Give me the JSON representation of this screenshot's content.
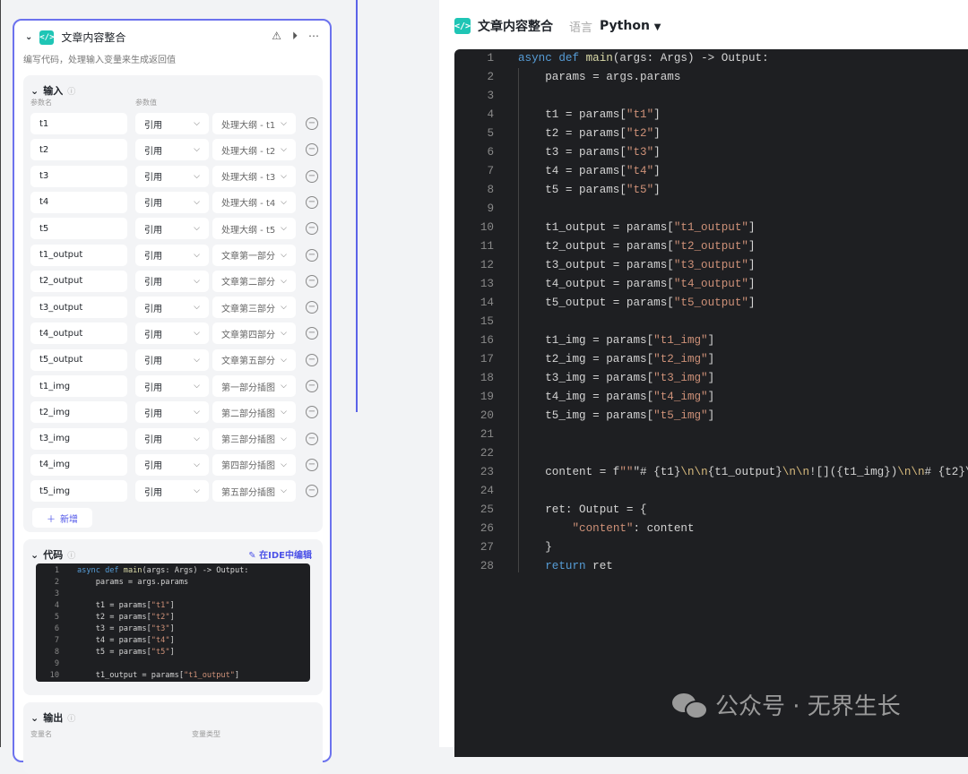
{
  "node": {
    "title": "文章内容整合",
    "description": "编写代码，处理输入变量来生成返回值",
    "input": {
      "title": "输入",
      "col_name": "参数名",
      "col_value": "参数值",
      "rows": [
        {
          "name": "t1",
          "type": "引用",
          "value": "处理大纲 - t1"
        },
        {
          "name": "t2",
          "type": "引用",
          "value": "处理大纲 - t2"
        },
        {
          "name": "t3",
          "type": "引用",
          "value": "处理大纲 - t3"
        },
        {
          "name": "t4",
          "type": "引用",
          "value": "处理大纲 - t4"
        },
        {
          "name": "t5",
          "type": "引用",
          "value": "处理大纲 - t5"
        },
        {
          "name": "t1_output",
          "type": "引用",
          "value": "文章第一部分"
        },
        {
          "name": "t2_output",
          "type": "引用",
          "value": "文章第二部分"
        },
        {
          "name": "t3_output",
          "type": "引用",
          "value": "文章第三部分"
        },
        {
          "name": "t4_output",
          "type": "引用",
          "value": "文章第四部分"
        },
        {
          "name": "t5_output",
          "type": "引用",
          "value": "文章第五部分"
        },
        {
          "name": "t1_img",
          "type": "引用",
          "value": "第一部分插图"
        },
        {
          "name": "t2_img",
          "type": "引用",
          "value": "第二部分插图"
        },
        {
          "name": "t3_img",
          "type": "引用",
          "value": "第三部分插图"
        },
        {
          "name": "t4_img",
          "type": "引用",
          "value": "第四部分插图"
        },
        {
          "name": "t5_img",
          "type": "引用",
          "value": "第五部分插图"
        }
      ],
      "add_label": "新增"
    },
    "code": {
      "title": "代码",
      "edit_in_ide": "在IDE中编辑"
    },
    "output": {
      "title": "输出",
      "col_name": "变量名",
      "col_type": "变量类型"
    }
  },
  "editor": {
    "title": "文章内容整合",
    "language_label": "语言",
    "language": "Python"
  },
  "code_lines": [
    "async def main(args: Args) -> Output:",
    "    params = args.params",
    "",
    "    t1 = params[\"t1\"]",
    "    t2 = params[\"t2\"]",
    "    t3 = params[\"t3\"]",
    "    t4 = params[\"t4\"]",
    "    t5 = params[\"t5\"]",
    "",
    "    t1_output = params[\"t1_output\"]",
    "    t2_output = params[\"t2_output\"]",
    "    t3_output = params[\"t3_output\"]",
    "    t4_output = params[\"t4_output\"]",
    "    t5_output = params[\"t5_output\"]",
    "",
    "    t1_img = params[\"t1_img\"]",
    "    t2_img = params[\"t2_img\"]",
    "    t3_img = params[\"t3_img\"]",
    "    t4_img = params[\"t4_img\"]",
    "    t5_img = params[\"t5_img\"]",
    "",
    "",
    "    content = f\"\"\"# {t1}\\n\\n{t1_output}\\n\\n![]({t1_img})\\n\\n# {t2}\\",
    "",
    "    ret: Output = {",
    "        \"content\": content",
    "    }",
    "    return ret"
  ],
  "watermark": "公众号 · 无界生长"
}
